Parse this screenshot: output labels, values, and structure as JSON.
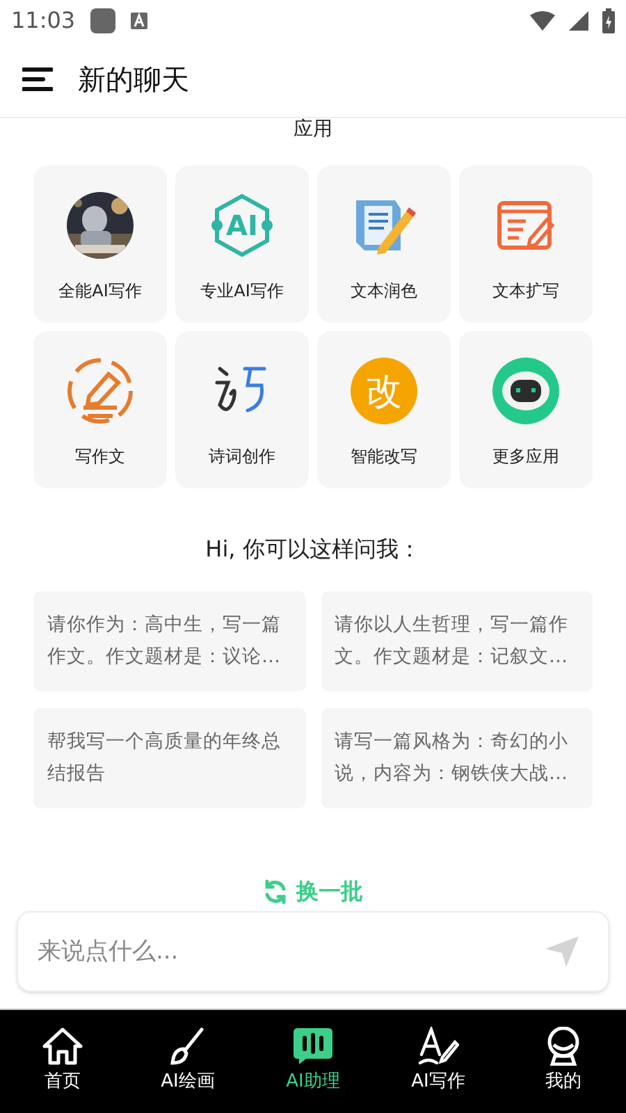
{
  "status_bar": {
    "time": "11:03"
  },
  "header": {
    "title": "新的聊天"
  },
  "section_title": "应用",
  "apps": [
    {
      "label": "全能AI写作"
    },
    {
      "label": "专业AI写作",
      "icon_text": "AI"
    },
    {
      "label": "文本润色"
    },
    {
      "label": "文本扩写"
    },
    {
      "label": "写作文"
    },
    {
      "label": "诗词创作"
    },
    {
      "label": "智能改写",
      "icon_text": "改"
    },
    {
      "label": "更多应用"
    }
  ],
  "prompt_heading": "Hi, 你可以这样问我：",
  "suggestions": [
    "请你作为：高中生，写一篇作文。作文题材是：议论…",
    "请你以人生哲理，写一篇作文。作文题材是：记叙文…",
    "帮我写一个高质量的年终总结报告",
    "请写一篇风格为：奇幻的小说，内容为：钢铁侠大战…"
  ],
  "refresh_button": "换一批",
  "input": {
    "placeholder": "来说点什么..."
  },
  "nav": [
    {
      "label": "首页",
      "selected": false
    },
    {
      "label": "AI绘画",
      "selected": false
    },
    {
      "label": "AI助理",
      "selected": true
    },
    {
      "label": "AI写作",
      "selected": false
    },
    {
      "label": "我的",
      "selected": false
    }
  ]
}
